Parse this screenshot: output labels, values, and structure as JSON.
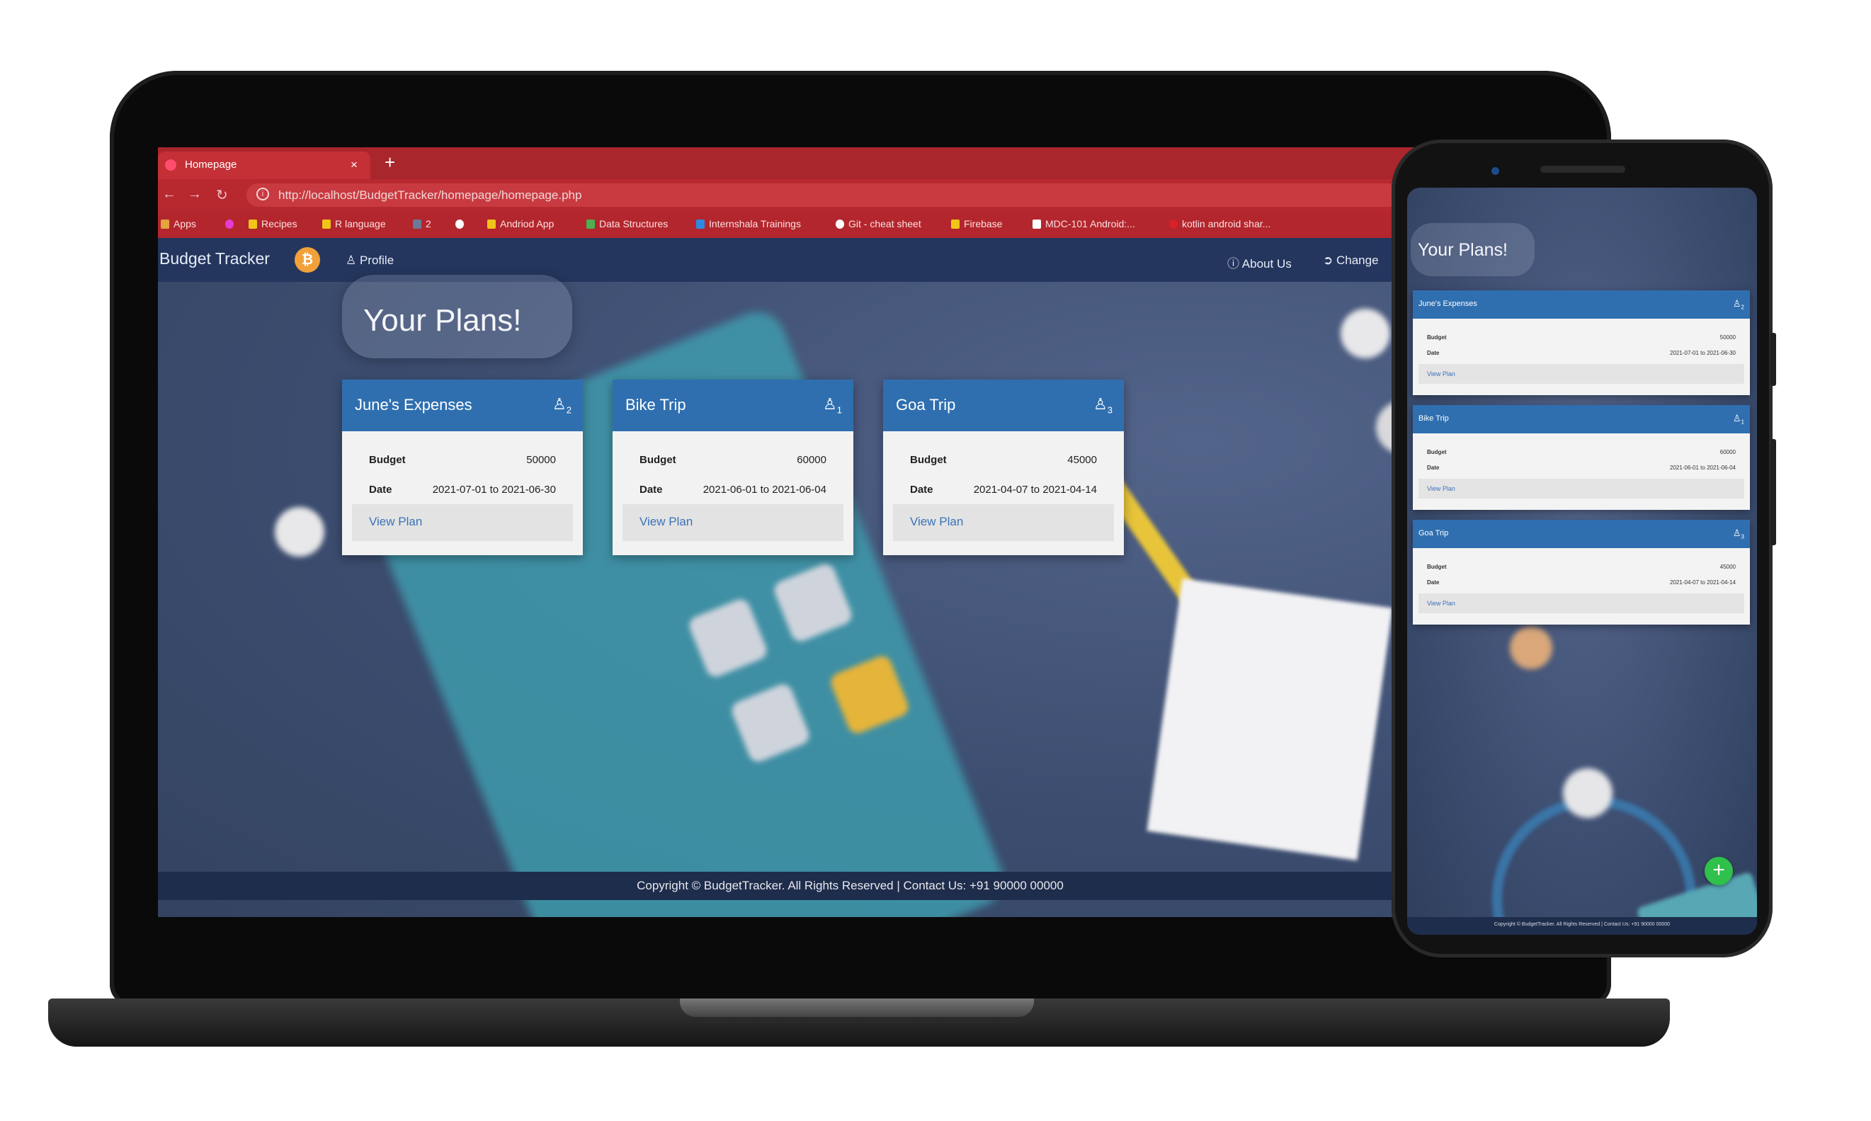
{
  "browser": {
    "tab_title": "Homepage",
    "tab_close": "×",
    "new_tab": "+",
    "back_icon": "←",
    "forward_icon": "→",
    "reload_icon": "↻",
    "info_icon": "i",
    "url": "http://localhost/BudgetTracker/homepage/homepage.php",
    "bookmarks": [
      "Apps",
      "Recipes",
      "R language",
      "2",
      "Andriod App",
      "Data Structures",
      "Internshala Trainings",
      "Git - cheat sheet",
      "Firebase",
      "MDC-101 Android:...",
      "kotlin android shar..."
    ]
  },
  "navbar": {
    "brand": "Budget Tracker",
    "brand_icon": "₿",
    "profile": "Profile",
    "about": "About Us",
    "change": "Change"
  },
  "hero_title": "Your Plans!",
  "labels": {
    "budget": "Budget",
    "date": "Date",
    "view_plan": "View Plan"
  },
  "plans": [
    {
      "title": "June's Expenses",
      "members": "2",
      "budget": "50000",
      "date": "2021-07-01 to 2021-06-30"
    },
    {
      "title": "Bike Trip",
      "members": "1",
      "budget": "60000",
      "date": "2021-06-01 to 2021-06-04"
    },
    {
      "title": "Goa Trip",
      "members": "3",
      "budget": "45000",
      "date": "2021-04-07 to 2021-04-14"
    }
  ],
  "footer": "Copyright © BudgetTracker. All Rights Reserved | Contact Us: +91 90000 00000",
  "phone": {
    "fab": "+",
    "footer": "Copyright © BudgetTracker. All Rights Reserved | Contact Us: +91 90000 00000"
  },
  "colors": {
    "tab_bar": "#a8262c",
    "navbar": "#24365e",
    "card_header": "#2f6fb0",
    "link": "#3b72b8",
    "fab": "#2fc14b"
  },
  "icons": [
    "user-icon",
    "info-icon",
    "sign-in-icon",
    "bitcoin-icon",
    "plus-icon"
  ]
}
